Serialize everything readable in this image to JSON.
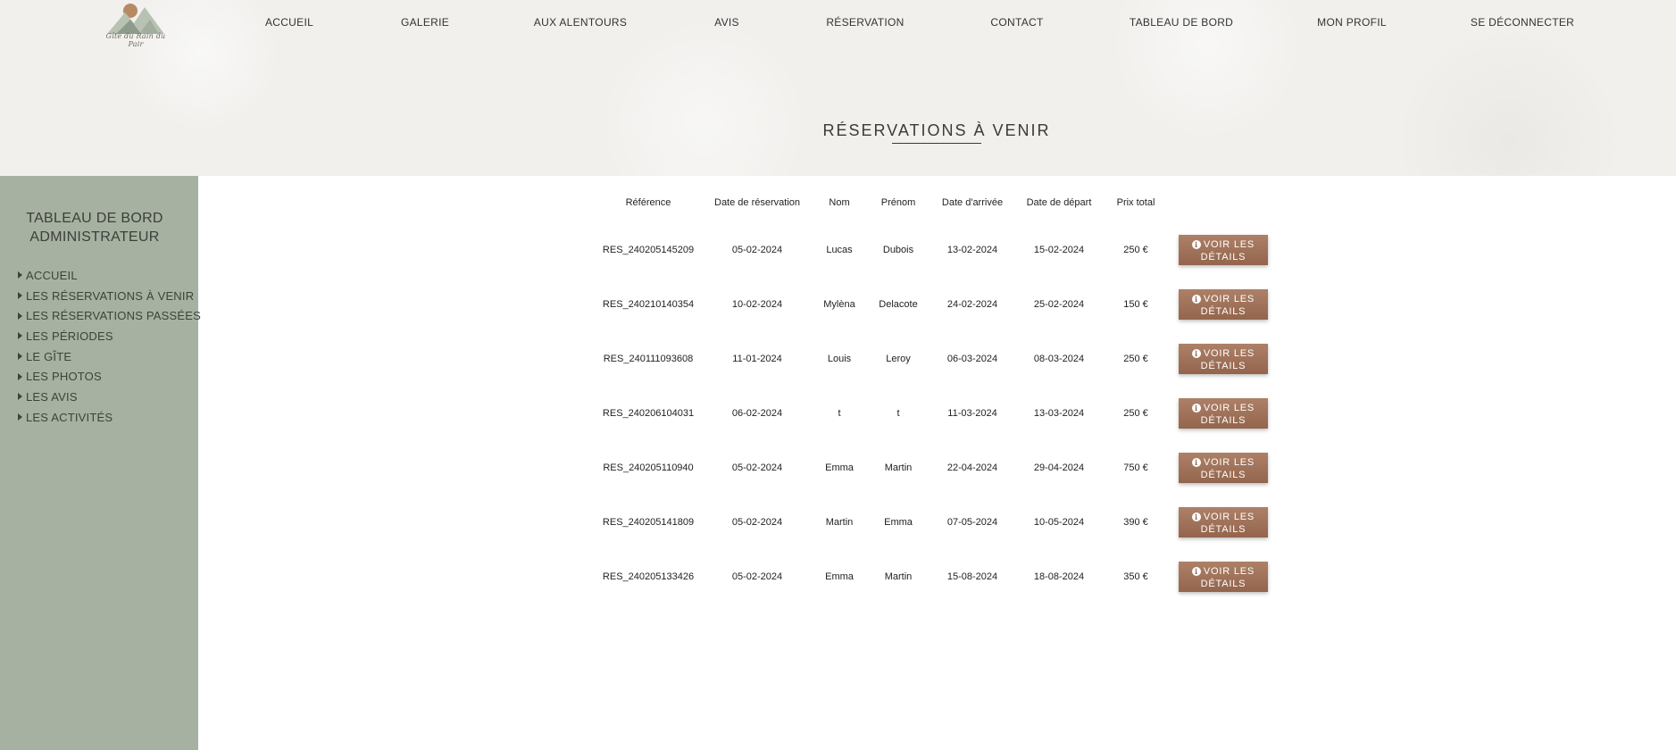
{
  "brand": {
    "logo_text": "Gîte du Rain du Pair"
  },
  "nav": {
    "items": [
      {
        "label": "ACCUEIL"
      },
      {
        "label": "GALERIE"
      },
      {
        "label": "AUX ALENTOURS"
      },
      {
        "label": "AVIS"
      },
      {
        "label": "RÉSERVATION"
      },
      {
        "label": "CONTACT"
      },
      {
        "label": "TABLEAU DE BORD"
      },
      {
        "label": "MON PROFIL"
      },
      {
        "label": "SE DÉCONNECTER"
      }
    ]
  },
  "page": {
    "title": "RÉSERVATIONS À VENIR"
  },
  "sidebar": {
    "title_line1": "TABLEAU DE BORD",
    "title_line2": "ADMINISTRATEUR",
    "items": [
      {
        "label": "ACCUEIL"
      },
      {
        "label": "LES RÉSERVATIONS À VENIR"
      },
      {
        "label": "LES RÉSERVATIONS PASSÉES"
      },
      {
        "label": "LES PÉRIODES"
      },
      {
        "label": "LE GÎTE"
      },
      {
        "label": "LES PHOTOS"
      },
      {
        "label": "LES AVIS"
      },
      {
        "label": "LES ACTIVITÉS"
      }
    ]
  },
  "table": {
    "headers": [
      "Référence",
      "Date de réservation",
      "Nom",
      "Prénom",
      "Date d'arrivée",
      "Date de départ",
      "Prix total"
    ],
    "button_line1": "VOIR LES",
    "button_line2": "DÉTAILS",
    "rows": [
      [
        "RES_240205145209",
        "05-02-2024",
        "Lucas",
        "Dubois",
        "13-02-2024",
        "15-02-2024",
        "250 €"
      ],
      [
        "RES_240210140354",
        "10-02-2024",
        "Mylèna",
        "Delacote",
        "24-02-2024",
        "25-02-2024",
        "150 €"
      ],
      [
        "RES_240111093608",
        "11-01-2024",
        "Louis",
        "Leroy",
        "06-03-2024",
        "08-03-2024",
        "250 €"
      ],
      [
        "RES_240206104031",
        "06-02-2024",
        "t",
        "t",
        "11-03-2024",
        "13-03-2024",
        "250 €"
      ],
      [
        "RES_240205110940",
        "05-02-2024",
        "Emma",
        "Martin",
        "22-04-2024",
        "29-04-2024",
        "750 €"
      ],
      [
        "RES_240205141809",
        "05-02-2024",
        "Martin",
        "Emma",
        "07-05-2024",
        "10-05-2024",
        "390 €"
      ],
      [
        "RES_240205133426",
        "05-02-2024",
        "Emma",
        "Martin",
        "15-08-2024",
        "18-08-2024",
        "350 €"
      ]
    ]
  },
  "colors": {
    "sidebar_bg": "#a7b1a1",
    "button_top": "#ad8067",
    "button_bottom": "#93654d",
    "header_bg": "#f1f0ed"
  }
}
